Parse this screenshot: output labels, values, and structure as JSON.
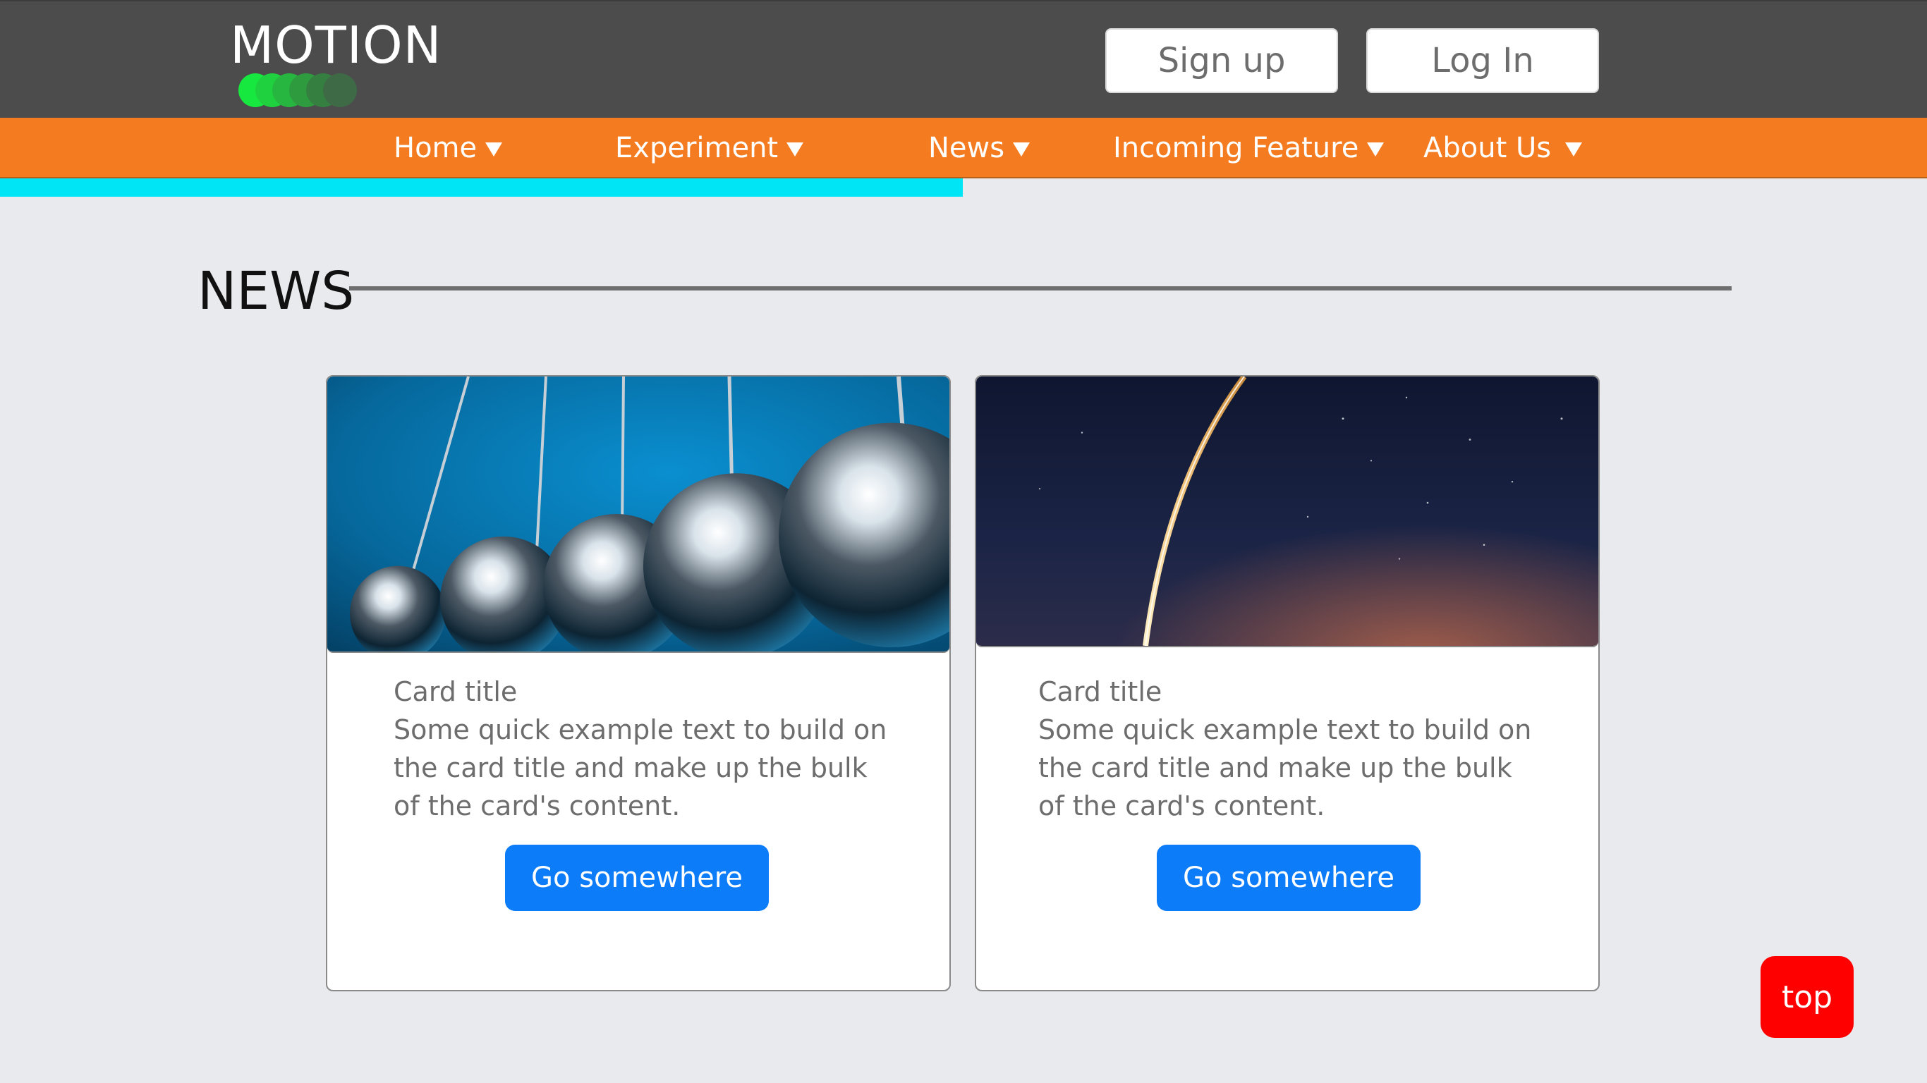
{
  "header": {
    "logo_text": "MOTION",
    "logo_dot_colors": [
      "#17e83f",
      "#1fd13f",
      "#27b63f",
      "#2e9b3f",
      "#357f41",
      "#3e6a45"
    ],
    "signup_label": "Sign up",
    "login_label": "Log In"
  },
  "nav": {
    "items": [
      {
        "label": "Home"
      },
      {
        "label": "Experiment"
      },
      {
        "label": "News"
      },
      {
        "label": "Incoming Feature"
      },
      {
        "label": "About Us"
      }
    ],
    "caret_icon": "caret-down-icon",
    "progress_percent": 50
  },
  "section": {
    "title": "NEWS"
  },
  "cards": [
    {
      "image": "newtons-cradle-image",
      "title": "Card title",
      "text": "Some quick example text to build on the card title and make up the bulk of the card's content.",
      "button_label": "Go somewhere"
    },
    {
      "image": "rocket-launch-trail-image",
      "title": "Card title",
      "text": "Some quick example text to build on the card title and make up the bulk of the card's content.",
      "button_label": "Go somewhere"
    }
  ],
  "top_button": {
    "label": "top"
  },
  "colors": {
    "header_bg": "#4c4c4c",
    "nav_bg": "#f47b20",
    "progress": "#00e5f5",
    "button_blue": "#0d7cf8",
    "top_red": "#ff0000"
  }
}
